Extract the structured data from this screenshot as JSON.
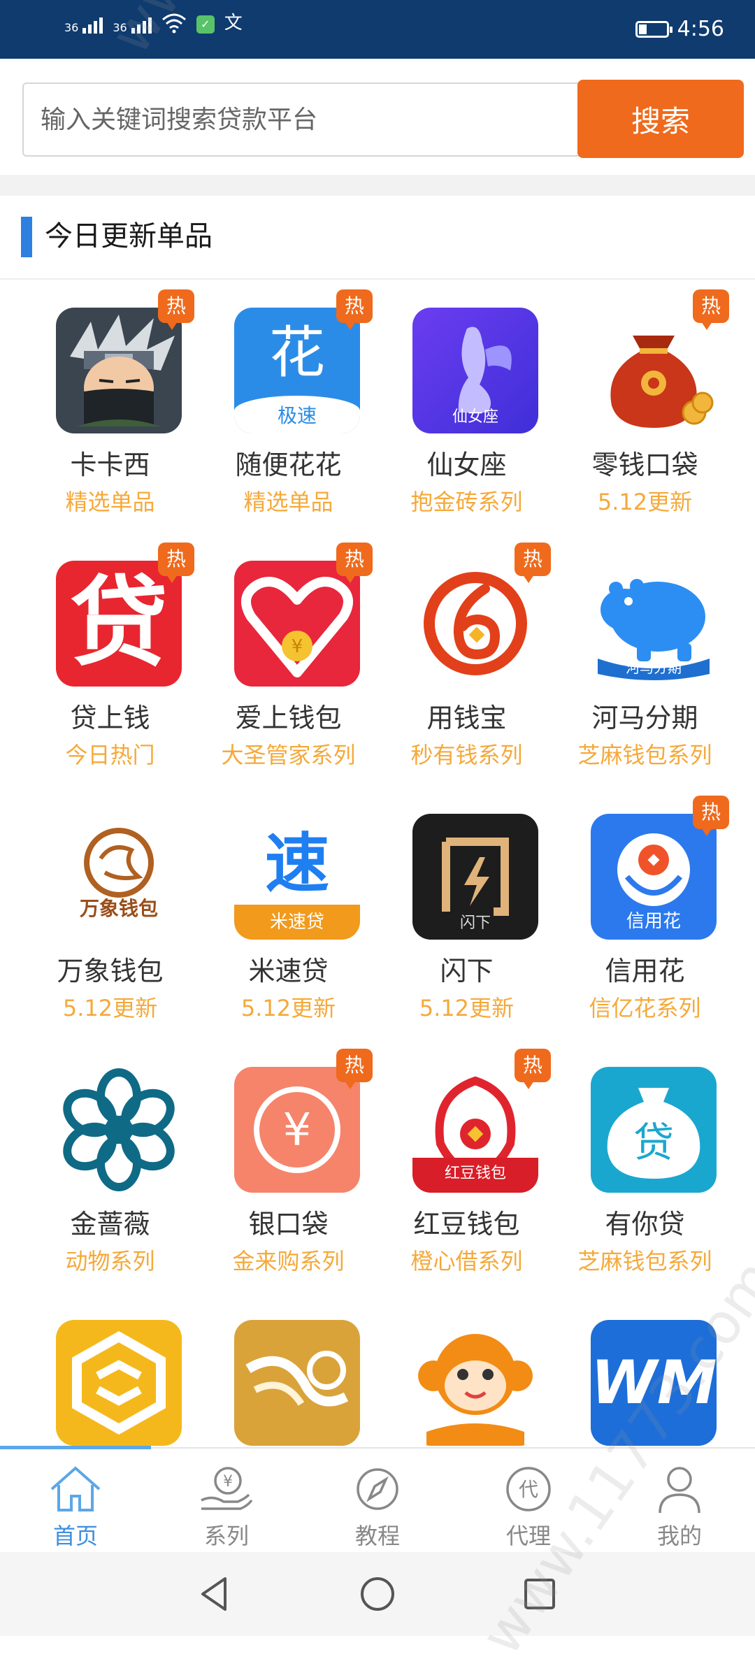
{
  "status_bar": {
    "signal_1_label": "36",
    "signal_2_label": "36",
    "extra_glyph": "文",
    "time": "4:56",
    "battery_level": 0.3
  },
  "search": {
    "placeholder": "输入关键词搜索贷款平台",
    "button_label": "搜索"
  },
  "section": {
    "title": "今日更新单品"
  },
  "hot_badge": "热",
  "items": [
    {
      "name": "卡卡西",
      "sub": "精选单品",
      "hot": true,
      "icon": "ninja-icon"
    },
    {
      "name": "随便花花",
      "sub": "精选单品",
      "hot": true,
      "icon": "hua-icon",
      "icon_text": "花",
      "icon_subtext": "极速"
    },
    {
      "name": "仙女座",
      "sub": "抱金砖系列",
      "hot": false,
      "icon": "fairy-icon",
      "icon_subtext": "仙女座"
    },
    {
      "name": "零钱口袋",
      "sub": "5.12更新",
      "hot": true,
      "icon": "money-bag-icon"
    },
    {
      "name": "贷上钱",
      "sub": "今日热门",
      "hot": true,
      "icon": "dai-icon",
      "icon_text": "贷"
    },
    {
      "name": "爱上钱包",
      "sub": "大圣管家系列",
      "hot": true,
      "icon": "heart-wallet-icon"
    },
    {
      "name": "用钱宝",
      "sub": "秒有钱系列",
      "hot": true,
      "icon": "six-ring-icon"
    },
    {
      "name": "河马分期",
      "sub": "芝麻钱包系列",
      "hot": false,
      "icon": "hippo-icon",
      "icon_subtext": "河马分期"
    },
    {
      "name": "万象钱包",
      "sub": "5.12更新",
      "hot": false,
      "icon": "wanxiang-icon",
      "icon_subtext": "万象钱包"
    },
    {
      "name": "米速贷",
      "sub": "5.12更新",
      "hot": false,
      "icon": "su-icon",
      "icon_text": "速",
      "icon_subtext": "米速贷"
    },
    {
      "name": "闪下",
      "sub": "5.12更新",
      "hot": false,
      "icon": "shan-icon",
      "icon_subtext": "闪下"
    },
    {
      "name": "信用花",
      "sub": "信亿花系列",
      "hot": true,
      "icon": "flower-coin-icon",
      "icon_subtext": "信用花"
    },
    {
      "name": "金蔷薇",
      "sub": "动物系列",
      "hot": false,
      "icon": "rose-icon"
    },
    {
      "name": "银口袋",
      "sub": "金来购系列",
      "hot": true,
      "icon": "yen-coin-icon"
    },
    {
      "name": "红豆钱包",
      "sub": "橙心借系列",
      "hot": true,
      "icon": "red-bean-icon",
      "icon_subtext": "红豆钱包"
    },
    {
      "name": "有你贷",
      "sub": "芝麻钱包系列",
      "hot": false,
      "icon": "pig-bag-icon",
      "icon_text": "贷"
    },
    {
      "name": "",
      "sub": "",
      "hot": false,
      "icon": "gold-cube-icon"
    },
    {
      "name": "",
      "sub": "",
      "hot": false,
      "icon": "gold-wave-icon"
    },
    {
      "name": "",
      "sub": "",
      "hot": false,
      "icon": "monkey-icon"
    },
    {
      "name": "",
      "sub": "",
      "hot": false,
      "icon": "wm-icon",
      "icon_text": "WM"
    }
  ],
  "tabs": [
    {
      "label": "首页",
      "icon": "home-icon",
      "active": true
    },
    {
      "label": "系列",
      "icon": "yen-hand-icon",
      "active": false
    },
    {
      "label": "教程",
      "icon": "compass-icon",
      "active": false
    },
    {
      "label": "代理",
      "icon": "agent-icon",
      "active": false,
      "icon_text": "代"
    },
    {
      "label": "我的",
      "icon": "user-icon",
      "active": false
    }
  ],
  "colors": {
    "status_bar": "#0f3b6e",
    "accent_orange": "#ef6a1c",
    "sub_text": "#f5a93a",
    "section_accent": "#2d7fe0",
    "tab_active": "#3d8fde"
  },
  "watermark": "www.11773.com"
}
